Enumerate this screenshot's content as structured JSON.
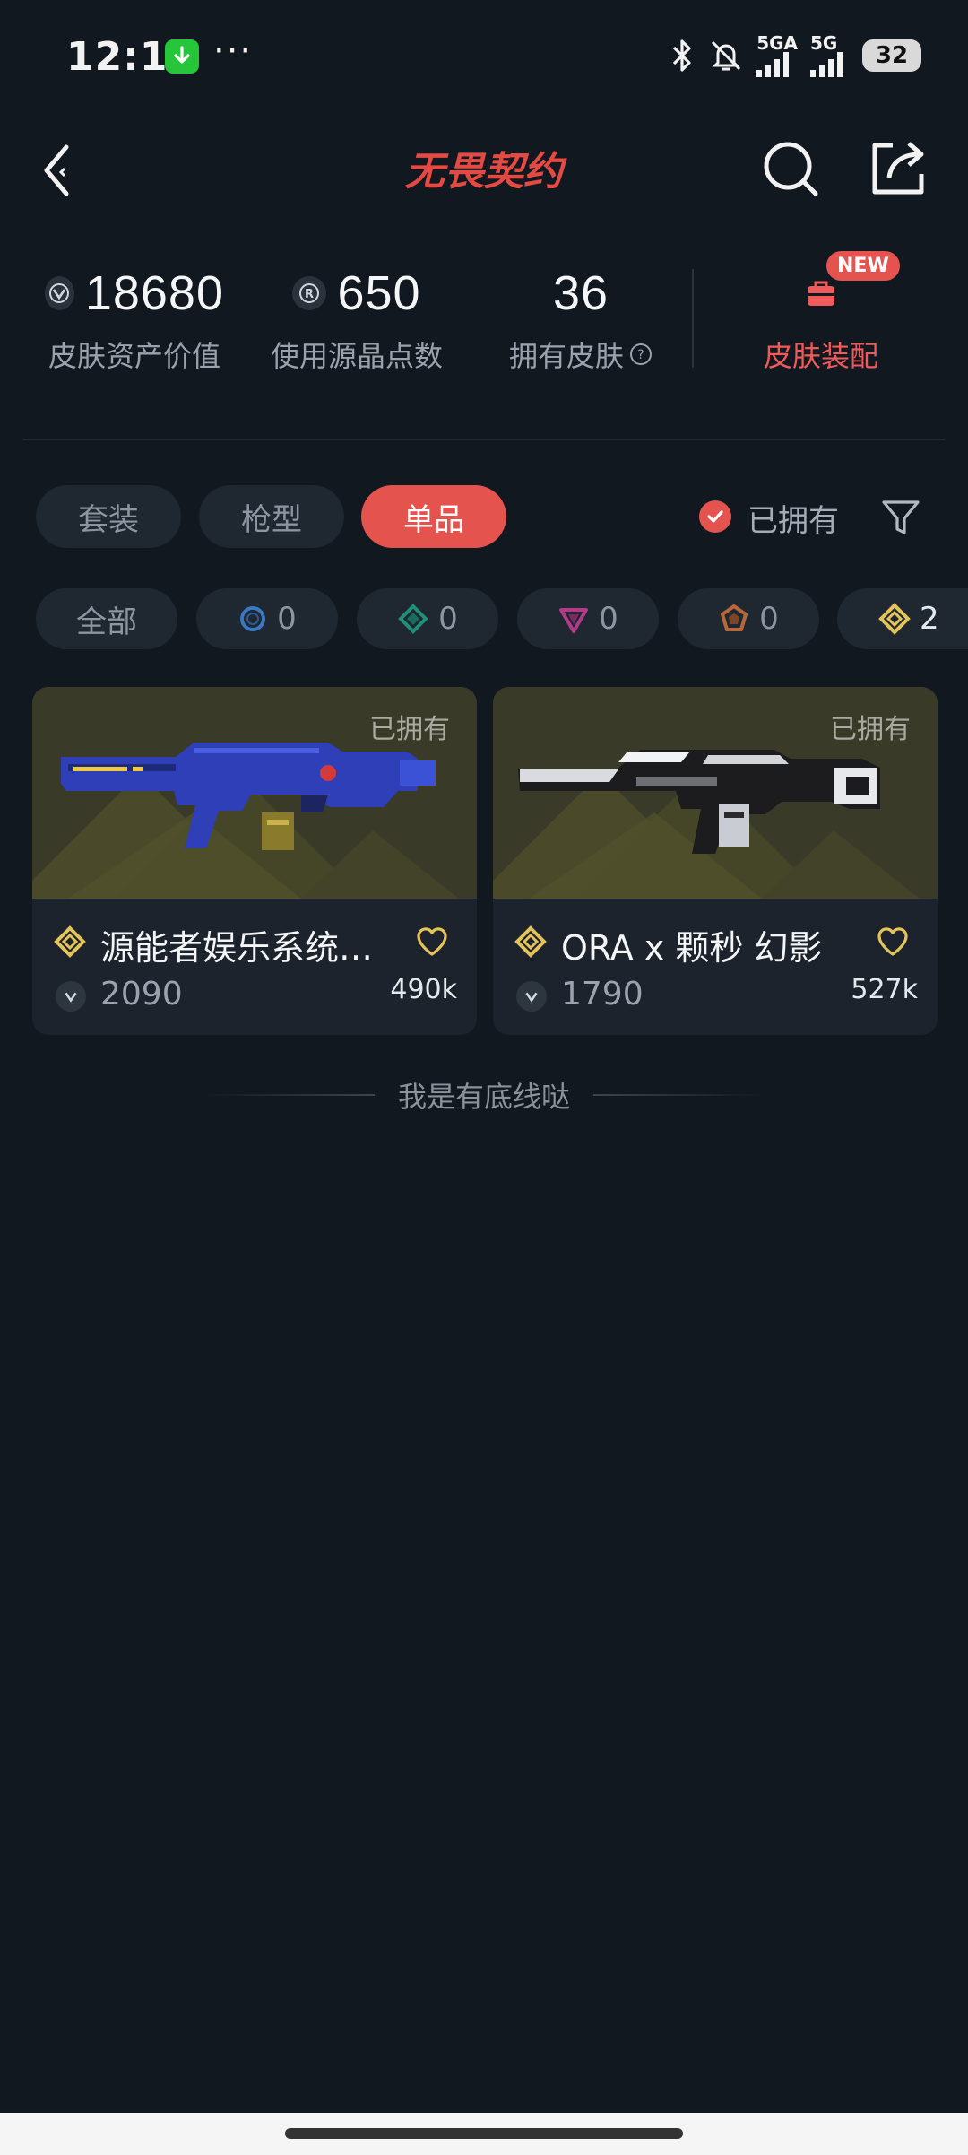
{
  "status_bar": {
    "time": "12:11",
    "more": "···",
    "net1": "5GA",
    "net2": "5G",
    "battery": "32"
  },
  "header": {
    "logo_text": "无畏契约"
  },
  "stats": [
    {
      "value": "18680",
      "label": "皮肤资产价值",
      "icon": "vp-icon"
    },
    {
      "value": "650",
      "label": "使用源晶点数",
      "icon": "radianite-icon"
    },
    {
      "value": "36",
      "label": "拥有皮肤",
      "icon": "help-icon"
    }
  ],
  "loadout": {
    "badge": "NEW",
    "label": "皮肤装配",
    "icon": "loadout-bag-icon"
  },
  "tabs": [
    {
      "label": "套装",
      "active": false
    },
    {
      "label": "枪型",
      "active": false
    },
    {
      "label": "单品",
      "active": true
    }
  ],
  "owned_filter": {
    "label": "已拥有",
    "checked": true
  },
  "tiers": [
    {
      "label": "全部"
    },
    {
      "count": "0",
      "icon": "select-tier-icon",
      "color": "#3a78c2"
    },
    {
      "count": "0",
      "icon": "deluxe-tier-icon",
      "color": "#1f8f7a"
    },
    {
      "count": "0",
      "icon": "premium-tier-icon",
      "color": "#b33a8a"
    },
    {
      "count": "0",
      "icon": "exclusive-tier-icon",
      "color": "#b8673a"
    },
    {
      "count": "2",
      "icon": "ultra-tier-icon",
      "color": "#e3c35a"
    }
  ],
  "skins": [
    {
      "owned": "已拥有",
      "name": "源能者娱乐系统…",
      "price": "2090",
      "likes": "490k"
    },
    {
      "owned": "已拥有",
      "name": "ORA x 颗秒 幻影",
      "price": "1790",
      "likes": "527k"
    }
  ],
  "footer_text": "我是有底线哒"
}
